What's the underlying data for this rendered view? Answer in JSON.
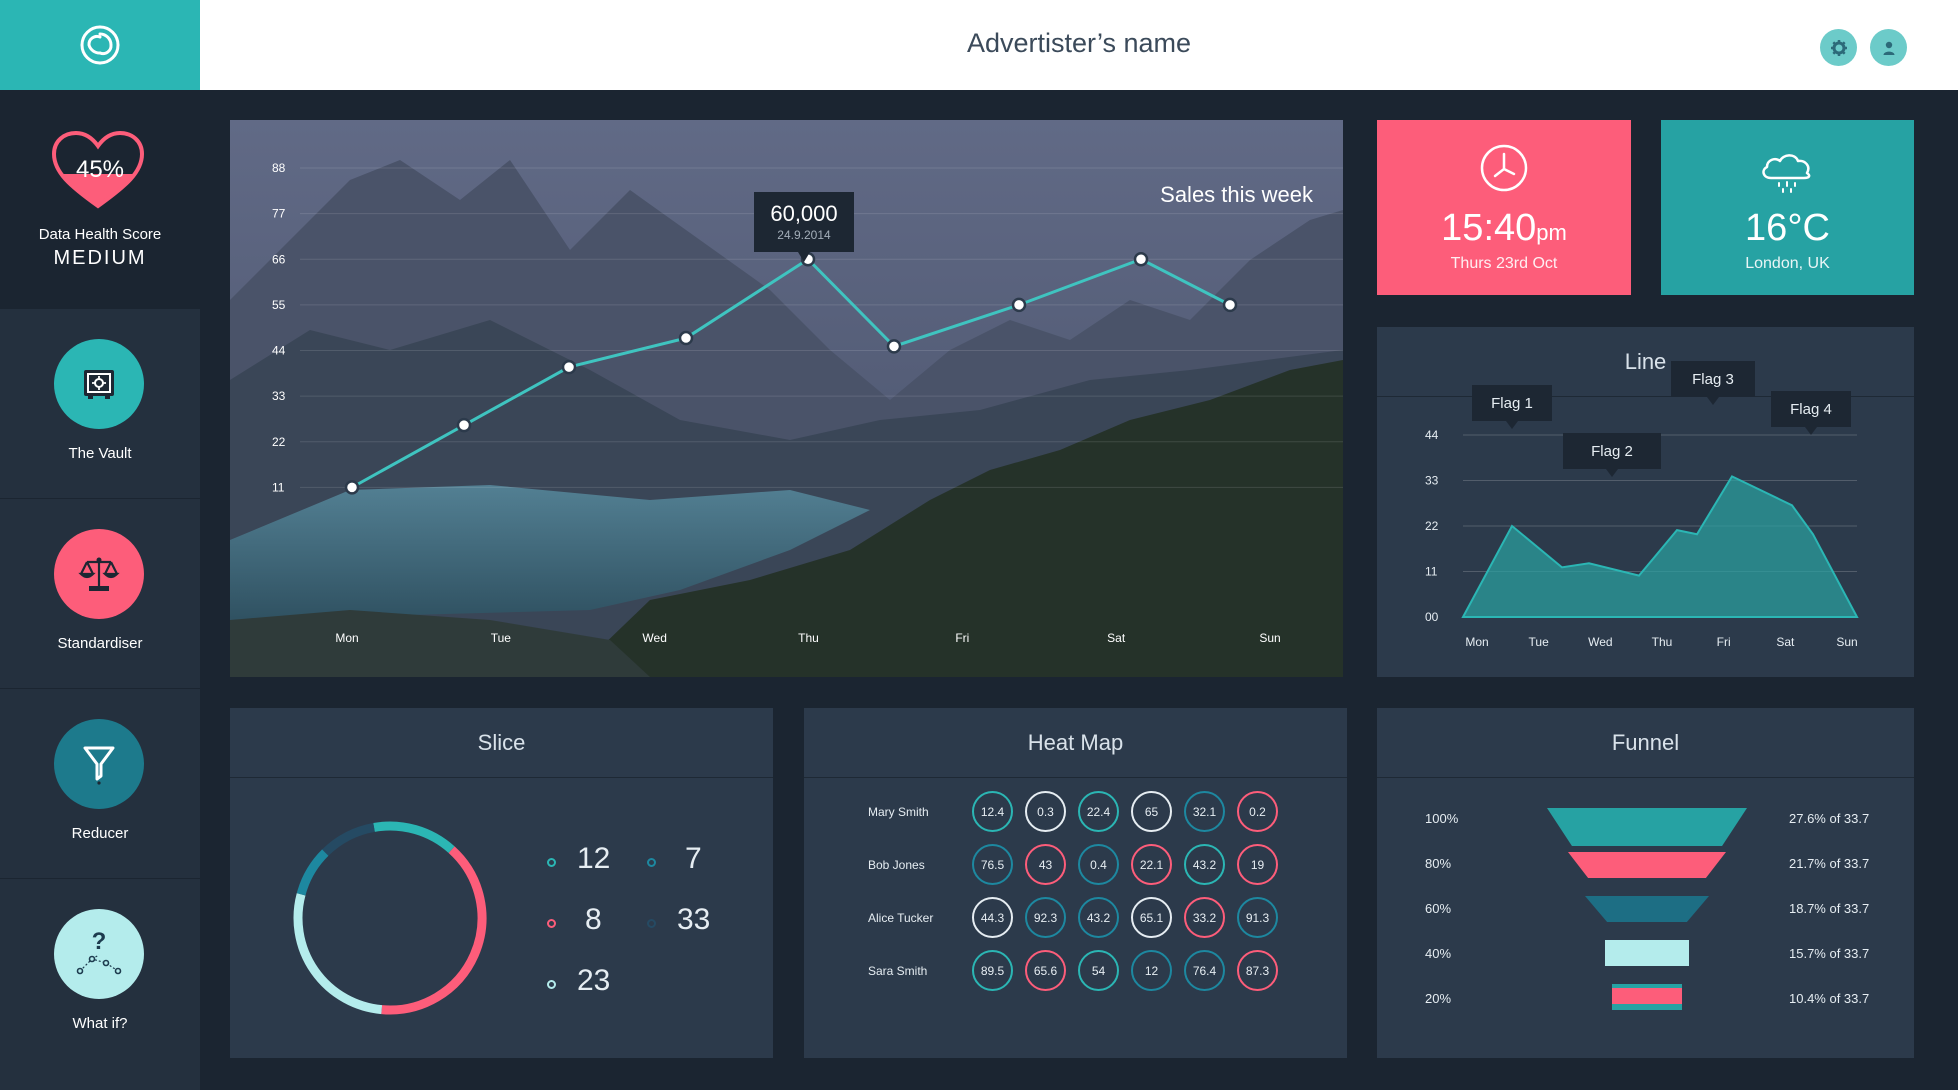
{
  "header": {
    "title": "Advertister’s name"
  },
  "icons": {
    "logo": "swirl-logo-icon",
    "settings": "gear-icon",
    "user": "user-icon"
  },
  "health": {
    "percent": "45%",
    "label": "Data Health Score",
    "level": "MEDIUM"
  },
  "sidebar": {
    "items": [
      {
        "label": "The Vault",
        "icon": "safe-icon",
        "color": "#2bb6b4"
      },
      {
        "label": "Standardiser",
        "icon": "scales-icon",
        "color": "#fd5d7a"
      },
      {
        "label": "Reducer",
        "icon": "funnel-icon",
        "color": "#1d7a8c"
      },
      {
        "label": "What if?",
        "icon": "question-network-icon",
        "color": "#b4ecec"
      }
    ]
  },
  "sales": {
    "title": "Sales this week",
    "tooltip_value": "60,000",
    "tooltip_date": "24.9.2014"
  },
  "clock": {
    "time": "15:40",
    "suffix": "pm",
    "date": "Thurs 23rd Oct",
    "icon": "clock-icon"
  },
  "weather": {
    "temp": "16°C",
    "location": "London, UK",
    "icon": "rain-cloud-icon"
  },
  "line_panel": {
    "title": "Line"
  },
  "slice": {
    "title": "Slice",
    "legend": [
      {
        "value": "12",
        "color": "#2bb6b4"
      },
      {
        "value": "7",
        "color": "#1d88a0"
      },
      {
        "value": "8",
        "color": "#fd5d7a"
      },
      {
        "value": "33",
        "color": "#254a63"
      },
      {
        "value": "23",
        "color": "#b4ecec"
      }
    ]
  },
  "heatmap": {
    "title": "Heat Map",
    "rows": [
      {
        "name": "Mary Smith",
        "cells": [
          [
            "12.4",
            "#2bb6b4"
          ],
          [
            "0.3",
            "#e6edf2"
          ],
          [
            "22.4",
            "#2bb6b4"
          ],
          [
            "65",
            "#e6edf2"
          ],
          [
            "32.1",
            "#1d88a0"
          ],
          [
            "0.2",
            "#fd5d7a"
          ]
        ]
      },
      {
        "name": "Bob Jones",
        "cells": [
          [
            "76.5",
            "#1d88a0"
          ],
          [
            "43",
            "#fd5d7a"
          ],
          [
            "0.4",
            "#1d88a0"
          ],
          [
            "22.1",
            "#fd5d7a"
          ],
          [
            "43.2",
            "#2bb6b4"
          ],
          [
            "19",
            "#fd5d7a"
          ]
        ]
      },
      {
        "name": "Alice Tucker",
        "cells": [
          [
            "44.3",
            "#e6edf2"
          ],
          [
            "92.3",
            "#1d88a0"
          ],
          [
            "43.2",
            "#1d88a0"
          ],
          [
            "65.1",
            "#e6edf2"
          ],
          [
            "33.2",
            "#fd5d7a"
          ],
          [
            "91.3",
            "#1d88a0"
          ]
        ]
      },
      {
        "name": "Sara Smith",
        "cells": [
          [
            "89.5",
            "#2bb6b4"
          ],
          [
            "65.6",
            "#fd5d7a"
          ],
          [
            "54",
            "#2bb6b4"
          ],
          [
            "12",
            "#1d88a0"
          ],
          [
            "76.4",
            "#1d88a0"
          ],
          [
            "87.3",
            "#fd5d7a"
          ]
        ]
      }
    ]
  },
  "funnel": {
    "title": "Funnel",
    "rows": [
      {
        "left": "100%",
        "right": "27.6% of 33.7",
        "color": "#26a2a3",
        "width": 1.0
      },
      {
        "left": "80%",
        "right": "21.7% of 33.7",
        "color": "#fd5d7a",
        "width": 0.79
      },
      {
        "left": "60%",
        "right": "18.7% of 33.7",
        "color": "#1d6e84",
        "width": 0.62
      },
      {
        "left": "40%",
        "right": "15.7% of 33.7",
        "color": "#b4ecec",
        "width": 0.42
      },
      {
        "left": "20%",
        "right": "10.4% of 33.7",
        "color": "#26a2a3",
        "width": 0.35
      },
      {
        "left": "",
        "right": "",
        "color": "#fd5d7a",
        "width": 0.35
      }
    ]
  },
  "chart_data": [
    {
      "type": "line",
      "title": "Sales this week",
      "categories": [
        "Mon",
        "Tue",
        "Wed",
        "Thu",
        "Fri",
        "Sat",
        "Sun"
      ],
      "x": [
        "Mon",
        "",
        "Tue",
        "Wed",
        "Thu",
        "",
        "Fri",
        "Sat",
        "Sun"
      ],
      "values": [
        11,
        26,
        40,
        47,
        66,
        45,
        55,
        66,
        55
      ],
      "yticks": [
        "88",
        "77",
        "66",
        "55",
        "44",
        "33",
        "22",
        "11"
      ],
      "ylim": [
        0,
        88
      ],
      "grid": true
    },
    {
      "type": "area",
      "title": "Line",
      "categories": [
        "Mon",
        "Tue",
        "Wed",
        "Thu",
        "Fri",
        "Sat",
        "Sun"
      ],
      "values": [
        0,
        22,
        12,
        13,
        10,
        21,
        20,
        34,
        27,
        20,
        0
      ],
      "yticks": [
        "44",
        "33",
        "22",
        "11",
        "00"
      ],
      "ylim": [
        0,
        44
      ],
      "flags": [
        "Flag 1",
        "Flag 2",
        "Flag 3",
        "Flag 4"
      ],
      "grid": true
    },
    {
      "type": "pie",
      "title": "Slice",
      "values": [
        12,
        7,
        8,
        33,
        23
      ]
    }
  ]
}
